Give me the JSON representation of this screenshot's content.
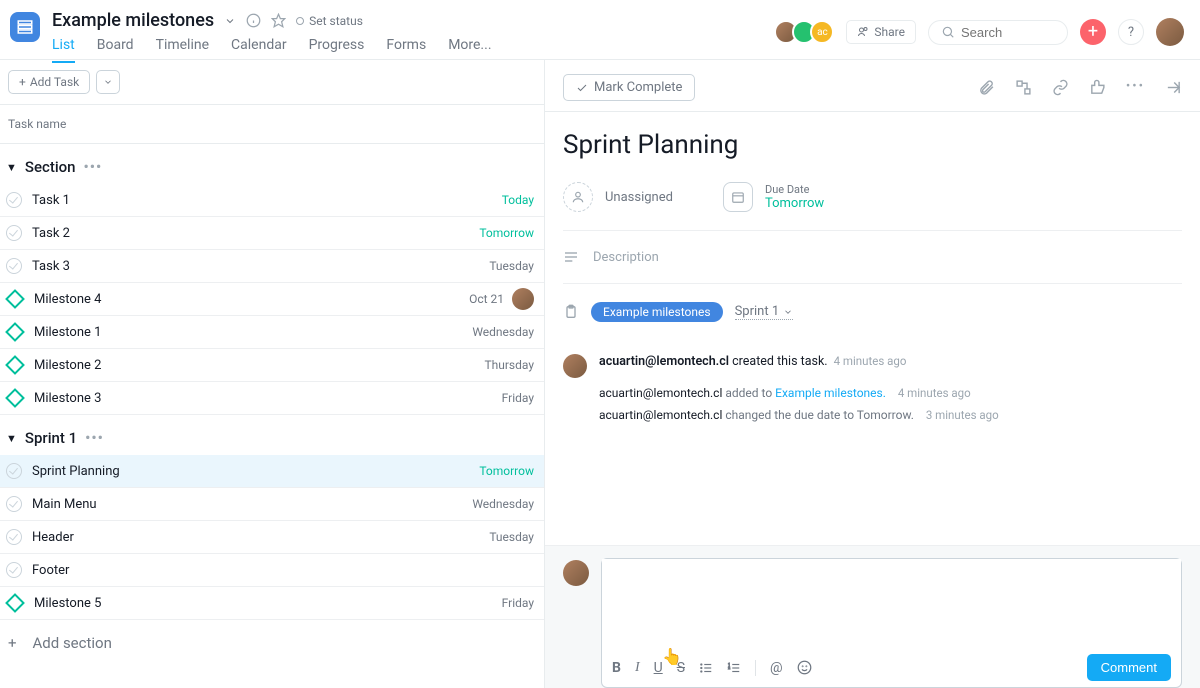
{
  "header": {
    "project_title": "Example milestones",
    "set_status": "Set status",
    "share_label": "Share",
    "search_placeholder": "Search",
    "tabs": [
      "List",
      "Board",
      "Timeline",
      "Calendar",
      "Progress",
      "Forms",
      "More..."
    ],
    "active_tab": "List"
  },
  "left": {
    "add_task": "Add Task",
    "col_header": "Task name",
    "add_section": "Add section",
    "sections": [
      {
        "name": "Section",
        "rows": [
          {
            "type": "task",
            "name": "Task 1",
            "date": "Today",
            "accent": true
          },
          {
            "type": "task",
            "name": "Task 2",
            "date": "Tomorrow",
            "accent": true
          },
          {
            "type": "task",
            "name": "Task 3",
            "date": "Tuesday",
            "accent": false
          },
          {
            "type": "milestone",
            "name": "Milestone 4",
            "date": "Oct 21",
            "accent": false,
            "avatar": true
          },
          {
            "type": "milestone",
            "name": "Milestone 1",
            "date": "Wednesday",
            "accent": false
          },
          {
            "type": "milestone",
            "name": "Milestone 2",
            "date": "Thursday",
            "accent": false
          },
          {
            "type": "milestone",
            "name": "Milestone 3",
            "date": "Friday",
            "accent": false
          }
        ]
      },
      {
        "name": "Sprint 1",
        "rows": [
          {
            "type": "task",
            "name": "Sprint Planning",
            "date": "Tomorrow",
            "accent": true,
            "selected": true
          },
          {
            "type": "task",
            "name": "Main Menu",
            "date": "Wednesday",
            "accent": false
          },
          {
            "type": "task",
            "name": "Header",
            "date": "Tuesday",
            "accent": false
          },
          {
            "type": "task",
            "name": "Footer",
            "date": "",
            "accent": false
          },
          {
            "type": "milestone",
            "name": "Milestone 5",
            "date": "Friday",
            "accent": false
          }
        ]
      }
    ]
  },
  "detail": {
    "mark_complete": "Mark Complete",
    "title": "Sprint Planning",
    "assignee_label": "Unassigned",
    "due_label": "Due Date",
    "due_value": "Tomorrow",
    "description_label": "Description",
    "project_pill": "Example milestones",
    "section_link": "Sprint 1",
    "activity": {
      "creator": "acuartin@lemontech.cl",
      "created_text": "created this task.",
      "created_time": "4 minutes ago",
      "events": [
        {
          "actor": "acuartin@lemontech.cl",
          "text": "added to",
          "link": "Example milestones.",
          "time": "4 minutes ago"
        },
        {
          "actor": "acuartin@lemontech.cl",
          "text": "changed the due date to Tomorrow.",
          "link": "",
          "time": "3 minutes ago"
        }
      ]
    },
    "comment_button": "Comment"
  }
}
